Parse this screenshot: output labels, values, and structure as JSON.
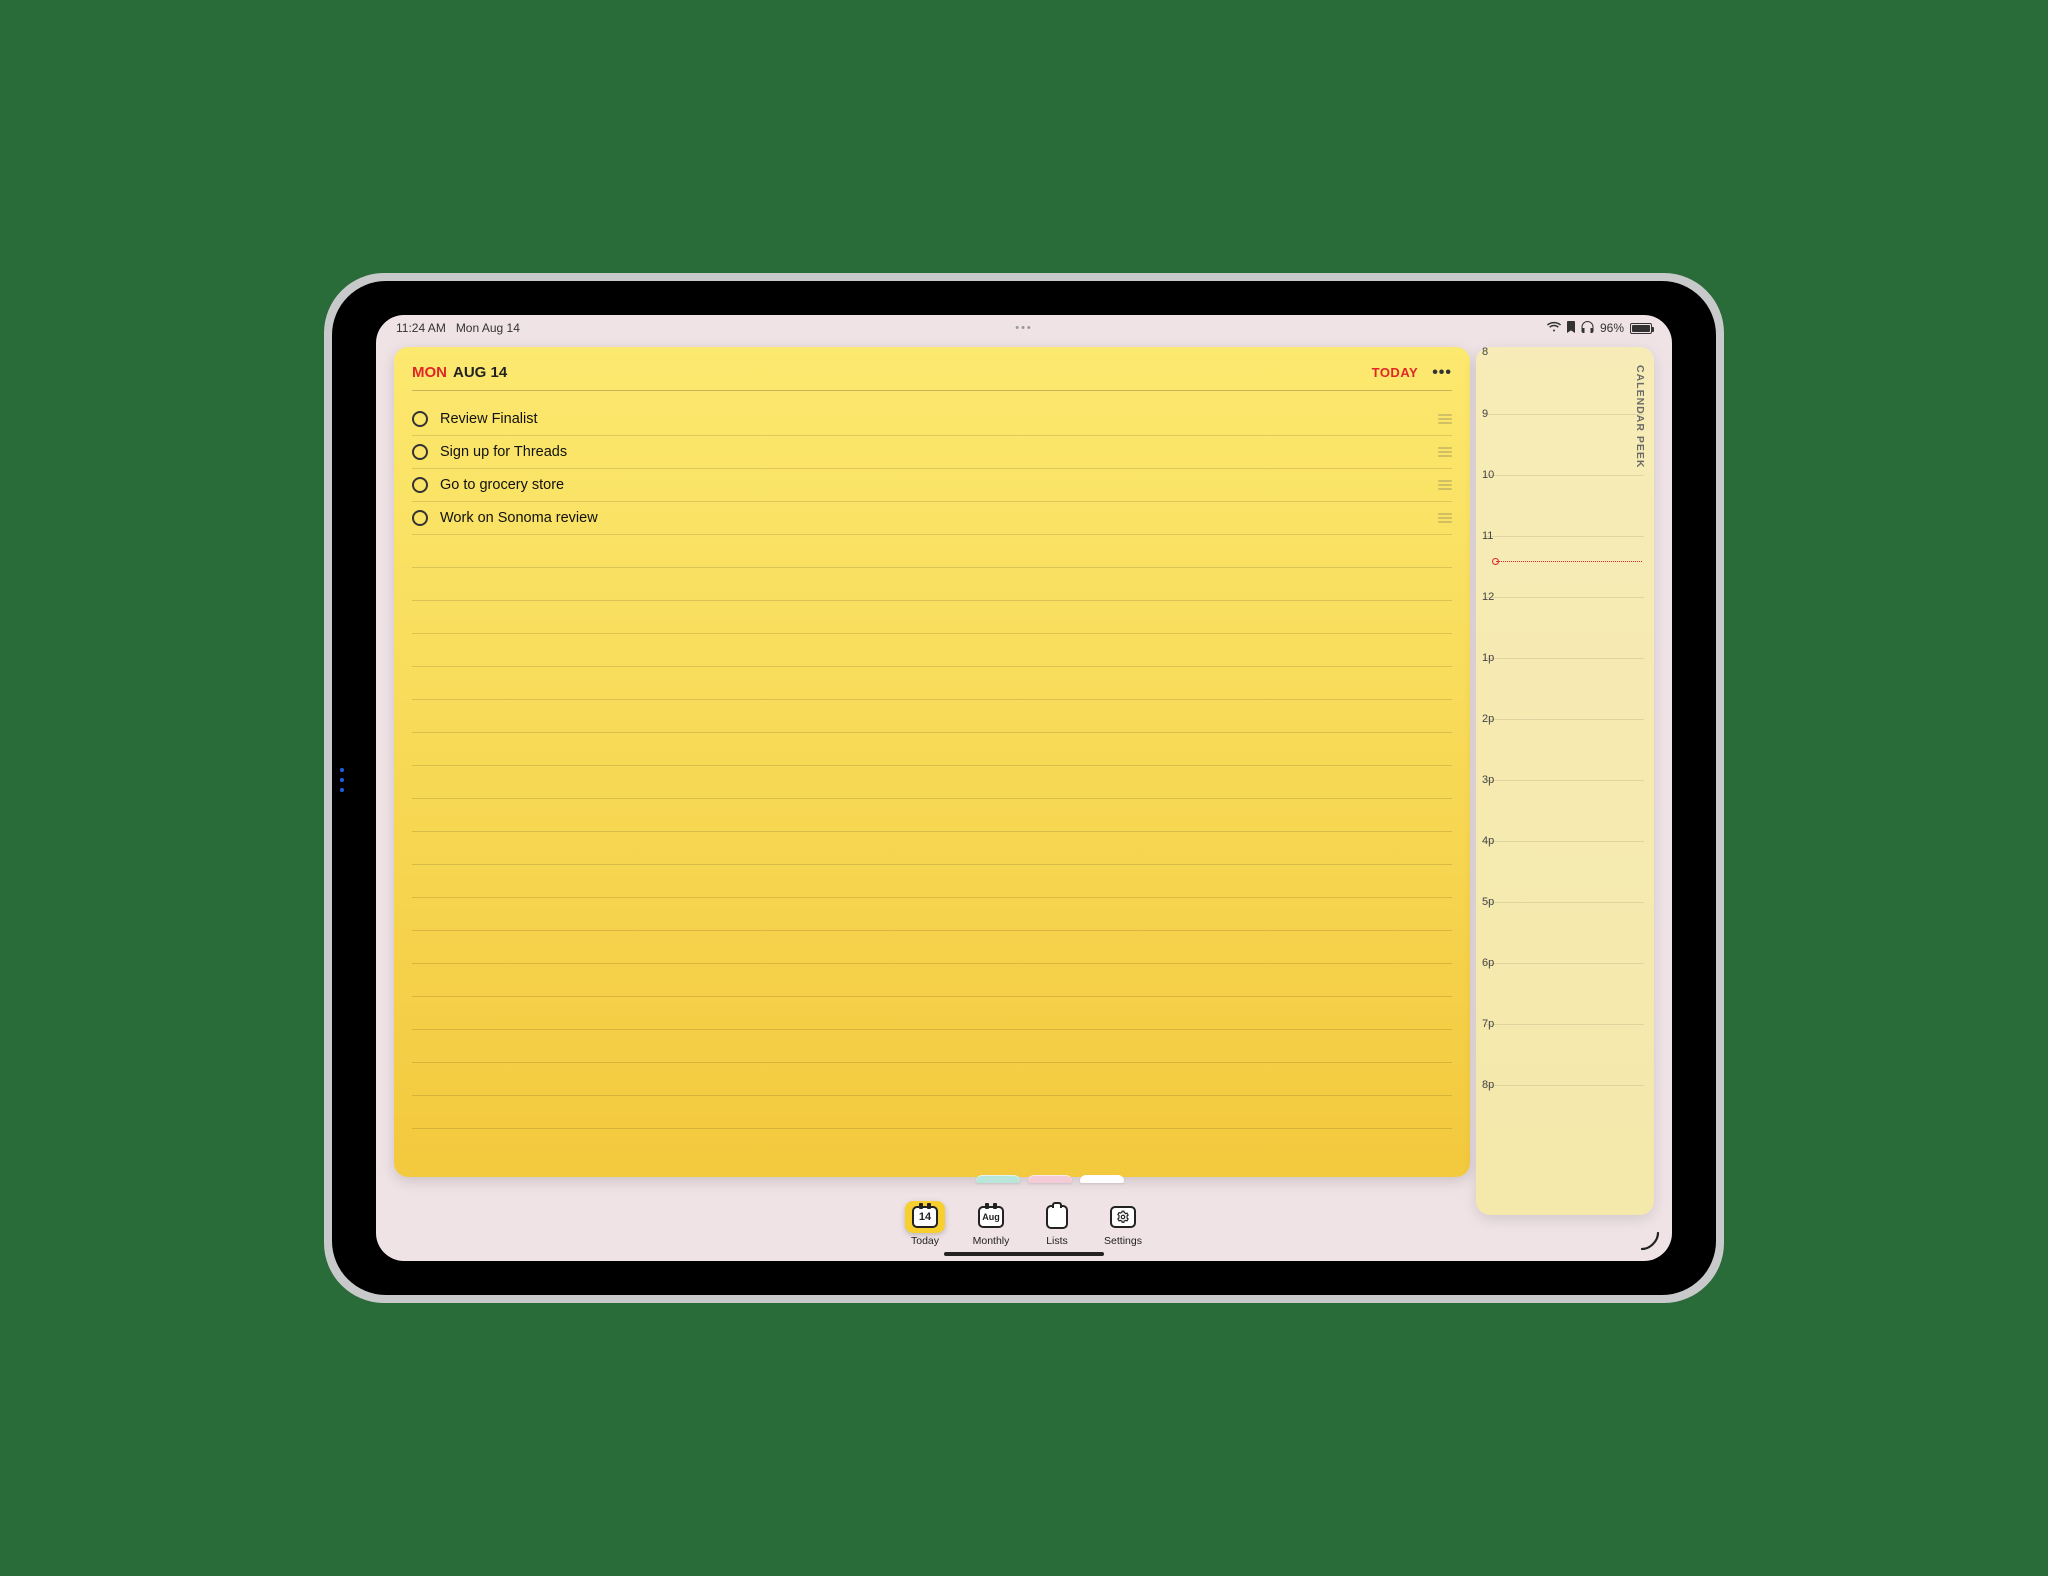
{
  "status": {
    "time": "11:24 AM",
    "date": "Mon Aug 14",
    "battery_pct": "96%",
    "icons": {
      "wifi": "wifi",
      "bookmark": "bookmark",
      "headphones": "headphones"
    }
  },
  "note": {
    "header": {
      "dow": "MON",
      "date": "AUG 14",
      "today_label": "TODAY"
    },
    "tasks": [
      {
        "label": "Review Finalist"
      },
      {
        "label": "Sign up for Threads"
      },
      {
        "label": "Go to grocery store"
      },
      {
        "label": "Work on Sonoma review"
      }
    ],
    "blank_lines": 18
  },
  "peek": {
    "title": "CALENDAR PEEK",
    "hours": [
      "8",
      "9",
      "10",
      "11",
      "12",
      "1p",
      "2p",
      "3p",
      "4p",
      "5p",
      "6p",
      "7p",
      "8p"
    ],
    "now_index": 3,
    "now_fraction": 0.4
  },
  "tabs": {
    "today": {
      "label": "Today",
      "day": "14"
    },
    "monthly": {
      "label": "Monthly",
      "month": "Aug"
    },
    "lists": {
      "label": "Lists"
    },
    "settings": {
      "label": "Settings"
    }
  }
}
